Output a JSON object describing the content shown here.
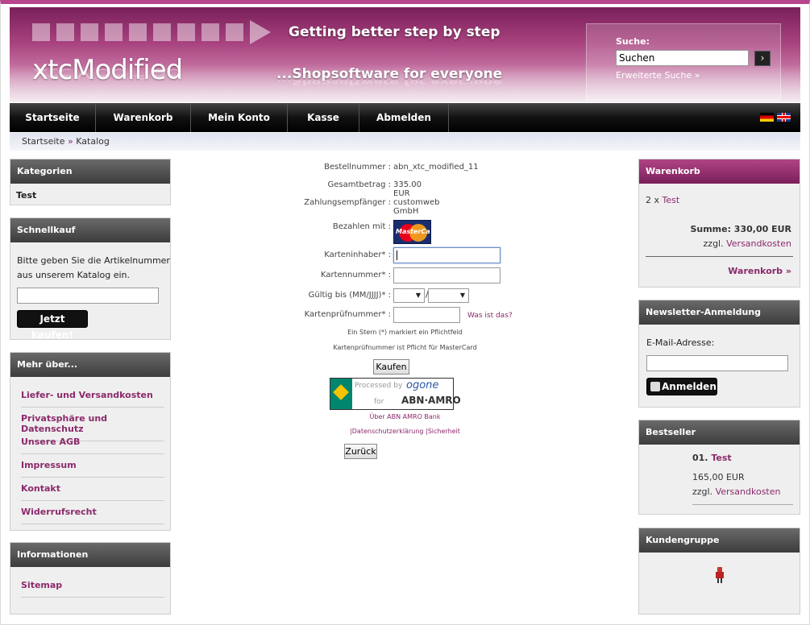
{
  "header": {
    "logo": "xtcModified",
    "tagline1": "Getting better step by step",
    "tagline2": "...Shopsoftware for everyone",
    "search_label": "Suche:",
    "search_value": "Suchen",
    "search_button": "›",
    "advanced_search": "Erweiterte Suche »"
  },
  "nav": [
    "Startseite",
    "Warenkorb",
    "Mein Konto",
    "Kasse",
    "Abmelden"
  ],
  "breadcrumb": {
    "home": "Startseite",
    "sep": " » ",
    "current": "Katalog"
  },
  "left": {
    "categories": {
      "title": "Kategorien",
      "item": "Test"
    },
    "quickbuy": {
      "title": "Schnellkauf",
      "text1": "Bitte geben Sie die Artikelnummer",
      "text2": "aus unserem Katalog ein.",
      "button": "Jetzt kaufen!"
    },
    "more": {
      "title": "Mehr über...",
      "items": [
        "Liefer- und Versandkosten",
        "Privatsphäre und Datenschutz",
        "Unsere AGB",
        "Impressum",
        "Kontakt",
        "Widerrufsrecht"
      ]
    },
    "info": {
      "title": "Informationen",
      "item": "Sitemap"
    }
  },
  "order": {
    "order_no_label": "Bestellnummer :",
    "order_no": "abn_xtc_modified_11",
    "total_label": "Gesamtbetrag :",
    "total": "335.00 EUR",
    "payee_label": "Zahlungsempfänger :",
    "payee": "customweb GmbH",
    "pay_with_label": "Bezahlen mit :",
    "card_name": "MasterCard",
    "holder_label": "Karteninhaber* :",
    "number_label": "Kartennummer* :",
    "valid_label": "Gültig bis (MM/JJJJ)* :",
    "valid_sep": "/",
    "cvc_label": "Kartenprüfnummer* :",
    "cvc_help": "Was ist das?",
    "note1": "Ein Stern (*) markiert ein Pflichtfeld",
    "note2": "Kartenprüfnummer ist Pflicht für MasterCard",
    "buy_button": "Kaufen",
    "ogone_processed": "Processed by",
    "ogone_brand": "ogone",
    "ogone_for": "for",
    "ogone_bank": "ABN·AMRO",
    "about_bank": "Über ABN AMRO Bank",
    "privacy_links": "|Datenschutzerklärung |Sicherheit",
    "back_button": "Zurück"
  },
  "right": {
    "cart": {
      "title": "Warenkorb",
      "qty": "2 x",
      "item": "Test",
      "sum": "Summe: 330,00 EUR",
      "shipping_prefix": "zzgl.",
      "shipping_link": "Versandkosten",
      "cart_link": "Warenkorb »"
    },
    "newsletter": {
      "title": "Newsletter-Anmeldung",
      "email_label": "E-Mail-Adresse:",
      "button": "Anmelden"
    },
    "bestseller": {
      "title": "Bestseller",
      "rank": "01.",
      "item": "Test",
      "price": "165,00 EUR",
      "shipping_prefix": "zzgl.",
      "shipping_link": "Versandkosten"
    },
    "customer_group": {
      "title": "Kundengruppe"
    }
  },
  "colors": {
    "accent": "#8b2a6b",
    "header": "#a8437f"
  }
}
